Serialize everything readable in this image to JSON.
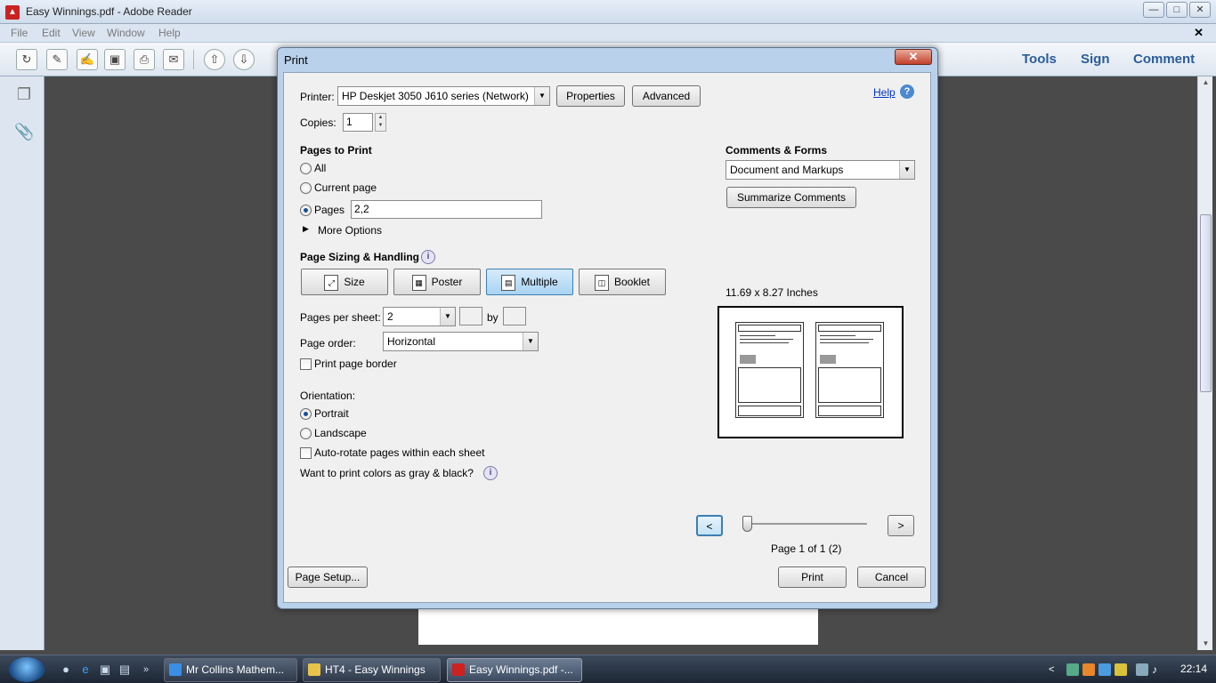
{
  "app": {
    "title": "Easy Winnings.pdf - Adobe Reader",
    "menu": [
      "File",
      "Edit",
      "View",
      "Window",
      "Help"
    ],
    "toolbar_right": [
      "Tools",
      "Sign",
      "Comment"
    ]
  },
  "dialog": {
    "title": "Print",
    "printer_label": "Printer:",
    "printer_value": "HP Deskjet 3050 J610 series (Network)",
    "properties_button": "Properties",
    "advanced_button": "Advanced",
    "help_link": "Help",
    "copies_label": "Copies:",
    "copies_value": "1",
    "pages_to_print": {
      "heading": "Pages to Print",
      "all": "All",
      "current_page": "Current page",
      "pages": "Pages",
      "pages_value": "2,2",
      "selected": "pages",
      "more_options": "More Options"
    },
    "sizing": {
      "heading": "Page Sizing & Handling",
      "buttons": [
        "Size",
        "Poster",
        "Multiple",
        "Booklet"
      ],
      "selected": "Multiple",
      "pages_per_sheet_label": "Pages per sheet:",
      "pages_per_sheet_value": "2",
      "by_label": "by",
      "page_order_label": "Page order:",
      "page_order_value": "Horizontal",
      "print_page_border": "Print page border"
    },
    "orientation": {
      "heading": "Orientation:",
      "portrait": "Portrait",
      "landscape": "Landscape",
      "selected": "Portrait",
      "auto_rotate": "Auto-rotate pages within each sheet"
    },
    "gray_question": "Want to print colors as gray & black?",
    "comments_forms": {
      "heading": "Comments & Forms",
      "value": "Document and Markups",
      "summarize_button": "Summarize Comments"
    },
    "preview": {
      "size_label": "11.69 x 8.27 Inches",
      "prev_button": "<",
      "next_button": ">",
      "page_status": "Page 1 of 1 (2)"
    },
    "page_setup_button": "Page Setup...",
    "print_button": "Print",
    "cancel_button": "Cancel"
  },
  "taskbar": {
    "tasks": [
      "Mr Collins Mathem...",
      "HT4 - Easy Winnings",
      "Easy Winnings.pdf -..."
    ],
    "clock": "22:14"
  }
}
